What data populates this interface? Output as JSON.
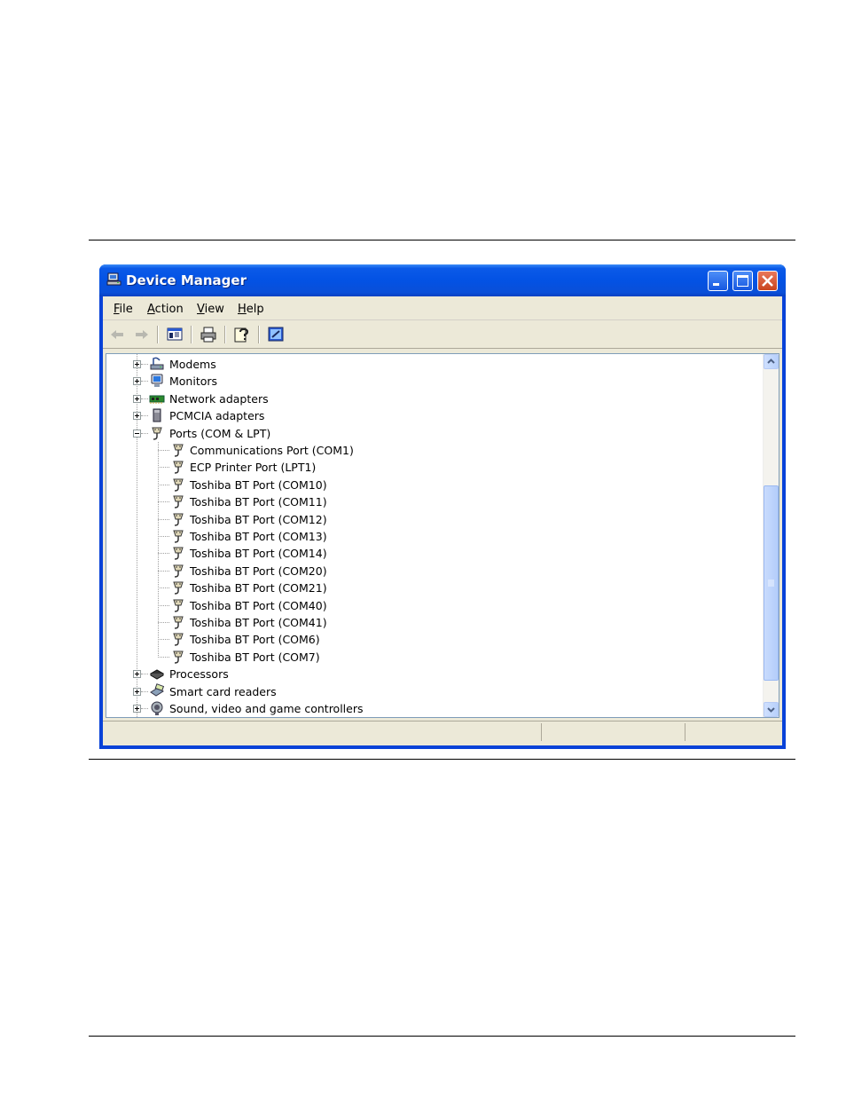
{
  "window": {
    "title": "Device Manager"
  },
  "menu": [
    {
      "label": "File",
      "accel": "F",
      "rest": "ile"
    },
    {
      "label": "Action",
      "accel": "A",
      "rest": "ction"
    },
    {
      "label": "View",
      "accel": "V",
      "rest": "iew"
    },
    {
      "label": "Help",
      "accel": "H",
      "rest": "elp"
    }
  ],
  "toolbar": {
    "buttons": [
      "back-arrow-icon",
      "forward-arrow-icon",
      "show-hide-tree-icon",
      "print-icon",
      "properties-help-icon",
      "scan-hardware-icon"
    ]
  },
  "tree": {
    "categories_top": [
      {
        "label": "Modems",
        "icon": "modem-icon",
        "expanded": false
      },
      {
        "label": "Monitors",
        "icon": "monitor-icon",
        "expanded": false
      },
      {
        "label": "Network adapters",
        "icon": "network-adapter-icon",
        "expanded": false
      },
      {
        "label": "PCMCIA adapters",
        "icon": "pcmcia-icon",
        "expanded": false
      },
      {
        "label": "Ports (COM & LPT)",
        "icon": "port-icon",
        "expanded": true
      }
    ],
    "ports": [
      "Communications Port (COM1)",
      "ECP Printer Port (LPT1)",
      "Toshiba BT Port (COM10)",
      "Toshiba BT Port (COM11)",
      "Toshiba BT Port (COM12)",
      "Toshiba BT Port (COM13)",
      "Toshiba BT Port (COM14)",
      "Toshiba BT Port (COM20)",
      "Toshiba BT Port (COM21)",
      "Toshiba BT Port (COM40)",
      "Toshiba BT Port (COM41)",
      "Toshiba BT Port (COM6)",
      "Toshiba BT Port (COM7)"
    ],
    "categories_bottom": [
      {
        "label": "Processors",
        "icon": "processor-icon",
        "expanded": false
      },
      {
        "label": "Smart card readers",
        "icon": "smart-card-reader-icon",
        "expanded": false
      },
      {
        "label": "Sound, video and game controllers",
        "icon": "sound-icon",
        "expanded": false
      }
    ]
  },
  "scroll": {
    "position_fraction": 0.36,
    "visible_fraction": 0.58
  },
  "statusbar": {
    "cells": [
      "",
      "",
      ""
    ]
  },
  "colors": {
    "titlebar": "#0352e4",
    "client": "#ece9d8",
    "close_button": "#c9441e"
  }
}
